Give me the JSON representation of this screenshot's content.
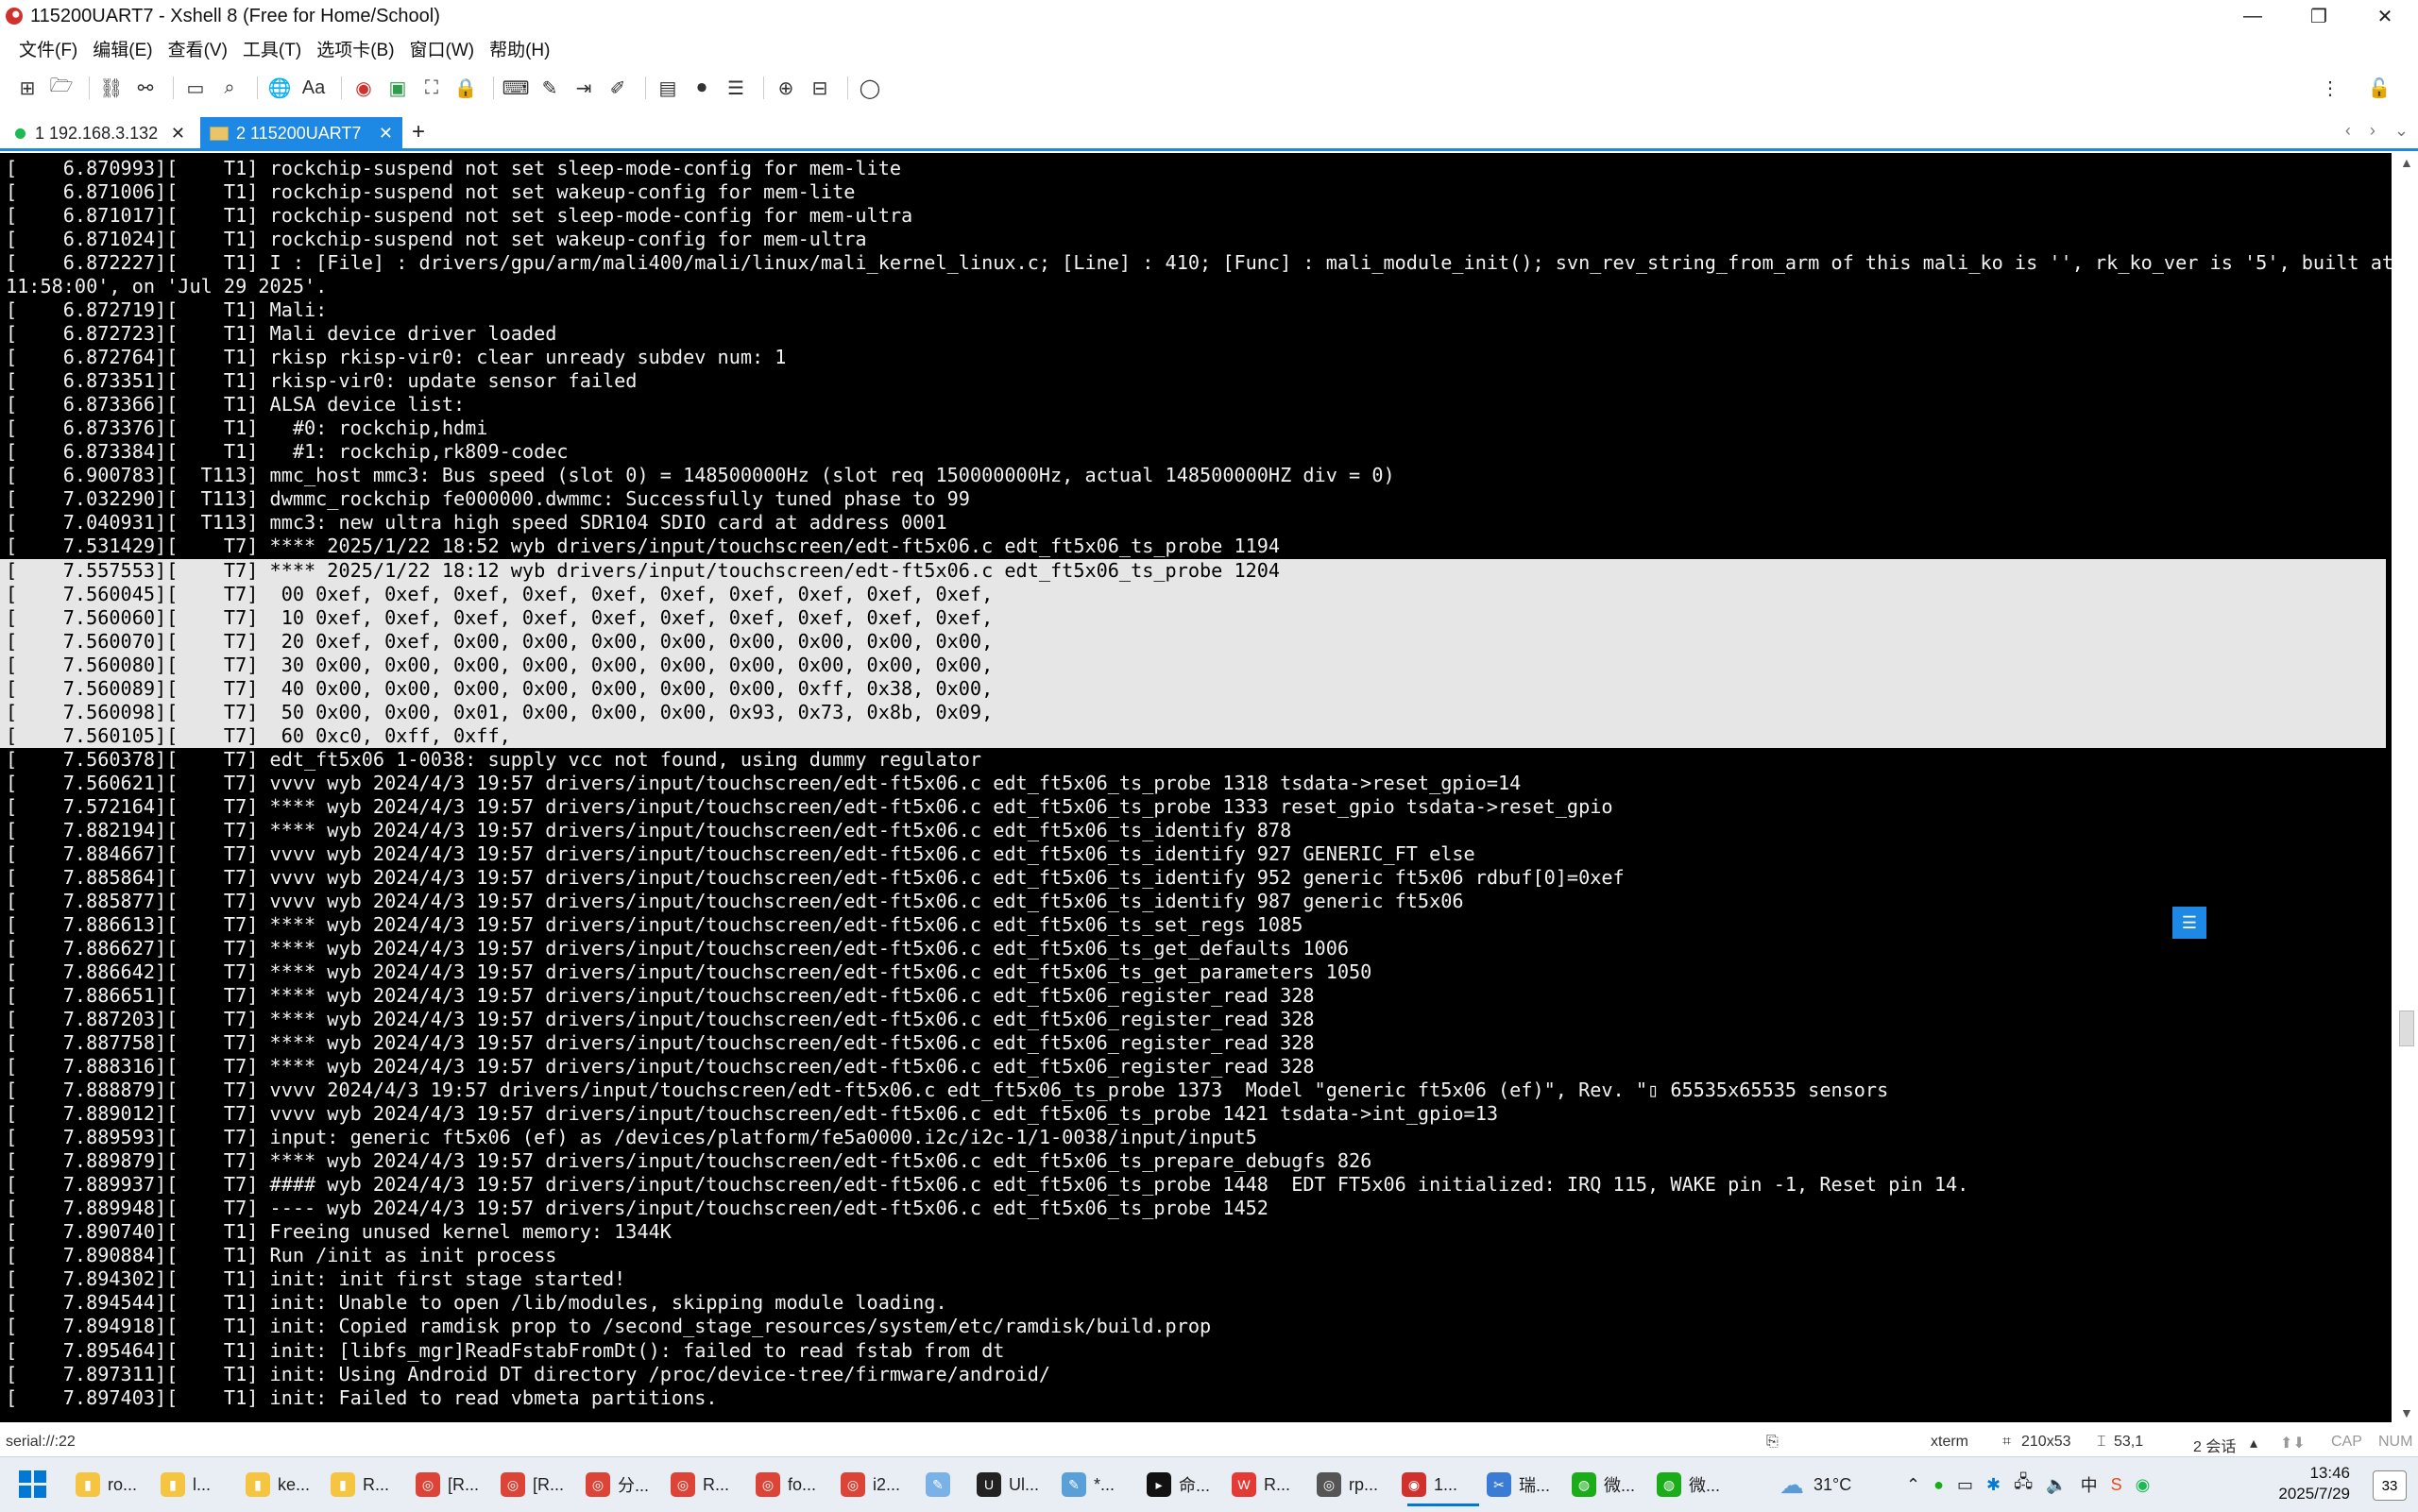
{
  "window": {
    "title": "115200UART7 - Xshell 8 (Free for Home/School)",
    "controls": [
      "—",
      "❐",
      "✕"
    ]
  },
  "menu": [
    "文件(F)",
    "编辑(E)",
    "查看(V)",
    "工具(T)",
    "选项卡(B)",
    "窗口(W)",
    "帮助(H)"
  ],
  "toolbar": {
    "font_label": "Aa"
  },
  "tabs": [
    {
      "label": "1 192.168.3.132",
      "active": false
    },
    {
      "label": "2 115200UART7",
      "active": true
    }
  ],
  "terminal": {
    "lines": [
      "[    6.870993][    T1] rockchip-suspend not set sleep-mode-config for mem-lite",
      "[    6.871006][    T1] rockchip-suspend not set wakeup-config for mem-lite",
      "[    6.871017][    T1] rockchip-suspend not set sleep-mode-config for mem-ultra",
      "[    6.871024][    T1] rockchip-suspend not set wakeup-config for mem-ultra",
      "[    6.872227][    T1] I : [File] : drivers/gpu/arm/mali400/mali/linux/mali_kernel_linux.c; [Line] : 410; [Func] : mali_module_init(); svn_rev_string_from_arm of this mali_ko is '', rk_ko_ver is '5', built at '",
      "11:58:00', on 'Jul 29 2025'.",
      "[    6.872719][    T1] Mali:",
      "[    6.872723][    T1] Mali device driver loaded",
      "[    6.872764][    T1] rkisp rkisp-vir0: clear unready subdev num: 1",
      "[    6.873351][    T1] rkisp-vir0: update sensor failed",
      "[    6.873366][    T1] ALSA device list:",
      "[    6.873376][    T1]   #0: rockchip,hdmi",
      "[    6.873384][    T1]   #1: rockchip,rk809-codec",
      "[    6.900783][  T113] mmc_host mmc3: Bus speed (slot 0) = 148500000Hz (slot req 150000000Hz, actual 148500000HZ div = 0)",
      "[    7.032290][  T113] dwmmc_rockchip fe000000.dwmmc: Successfully tuned phase to 99",
      "[    7.040931][  T113] mmc3: new ultra high speed SDR104 SDIO card at address 0001",
      "[    7.531429][    T7] **** 2025/1/22 18:52 wyb drivers/input/touchscreen/edt-ft5x06.c edt_ft5x06_ts_probe 1194",
      "[    7.557553][    T7] **** 2025/1/22 18:12 wyb drivers/input/touchscreen/edt-ft5x06.c edt_ft5x06_ts_probe 1204",
      "[    7.560045][    T7]  00 0xef, 0xef, 0xef, 0xef, 0xef, 0xef, 0xef, 0xef, 0xef, 0xef,",
      "[    7.560060][    T7]  10 0xef, 0xef, 0xef, 0xef, 0xef, 0xef, 0xef, 0xef, 0xef, 0xef,",
      "[    7.560070][    T7]  20 0xef, 0xef, 0x00, 0x00, 0x00, 0x00, 0x00, 0x00, 0x00, 0x00,",
      "[    7.560080][    T7]  30 0x00, 0x00, 0x00, 0x00, 0x00, 0x00, 0x00, 0x00, 0x00, 0x00,",
      "[    7.560089][    T7]  40 0x00, 0x00, 0x00, 0x00, 0x00, 0x00, 0x00, 0xff, 0x38, 0x00,",
      "[    7.560098][    T7]  50 0x00, 0x00, 0x01, 0x00, 0x00, 0x00, 0x93, 0x73, 0x8b, 0x09,",
      "[    7.560105][    T7]  60 0xc0, 0xff, 0xff,",
      "[    7.560378][    T7] edt_ft5x06 1-0038: supply vcc not found, using dummy regulator",
      "[    7.560621][    T7] vvvv wyb 2024/4/3 19:57 drivers/input/touchscreen/edt-ft5x06.c edt_ft5x06_ts_probe 1318 tsdata->reset_gpio=14",
      "[    7.572164][    T7] **** wyb 2024/4/3 19:57 drivers/input/touchscreen/edt-ft5x06.c edt_ft5x06_ts_probe 1333 reset_gpio tsdata->reset_gpio",
      "[    7.882194][    T7] **** wyb 2024/4/3 19:57 drivers/input/touchscreen/edt-ft5x06.c edt_ft5x06_ts_identify 878",
      "[    7.884667][    T7] vvvv wyb 2024/4/3 19:57 drivers/input/touchscreen/edt-ft5x06.c edt_ft5x06_ts_identify 927 GENERIC_FT else",
      "[    7.885864][    T7] vvvv wyb 2024/4/3 19:57 drivers/input/touchscreen/edt-ft5x06.c edt_ft5x06_ts_identify 952 generic ft5x06 rdbuf[0]=0xef",
      "[    7.885877][    T7] vvvv wyb 2024/4/3 19:57 drivers/input/touchscreen/edt-ft5x06.c edt_ft5x06_ts_identify 987 generic ft5x06",
      "[    7.886613][    T7] **** wyb 2024/4/3 19:57 drivers/input/touchscreen/edt-ft5x06.c edt_ft5x06_ts_set_regs 1085",
      "[    7.886627][    T7] **** wyb 2024/4/3 19:57 drivers/input/touchscreen/edt-ft5x06.c edt_ft5x06_ts_get_defaults 1006",
      "[    7.886642][    T7] **** wyb 2024/4/3 19:57 drivers/input/touchscreen/edt-ft5x06.c edt_ft5x06_ts_get_parameters 1050",
      "[    7.886651][    T7] **** wyb 2024/4/3 19:57 drivers/input/touchscreen/edt-ft5x06.c edt_ft5x06_register_read 328",
      "[    7.887203][    T7] **** wyb 2024/4/3 19:57 drivers/input/touchscreen/edt-ft5x06.c edt_ft5x06_register_read 328",
      "[    7.887758][    T7] **** wyb 2024/4/3 19:57 drivers/input/touchscreen/edt-ft5x06.c edt_ft5x06_register_read 328",
      "[    7.888316][    T7] **** wyb 2024/4/3 19:57 drivers/input/touchscreen/edt-ft5x06.c edt_ft5x06_register_read 328",
      "[    7.888879][    T7] vvvv 2024/4/3 19:57 drivers/input/touchscreen/edt-ft5x06.c edt_ft5x06_ts_probe 1373  Model \"generic ft5x06 (ef)\", Rev. \"▯ 65535x65535 sensors",
      "[    7.889012][    T7] vvvv wyb 2024/4/3 19:57 drivers/input/touchscreen/edt-ft5x06.c edt_ft5x06_ts_probe 1421 tsdata->int_gpio=13",
      "[    7.889593][    T7] input: generic ft5x06 (ef) as /devices/platform/fe5a0000.i2c/i2c-1/1-0038/input/input5",
      "[    7.889879][    T7] **** wyb 2024/4/3 19:57 drivers/input/touchscreen/edt-ft5x06.c edt_ft5x06_ts_prepare_debugfs 826",
      "[    7.889937][    T7] #### wyb 2024/4/3 19:57 drivers/input/touchscreen/edt-ft5x06.c edt_ft5x06_ts_probe 1448  EDT FT5x06 initialized: IRQ 115, WAKE pin -1, Reset pin 14.",
      "[    7.889948][    T7] ---- wyb 2024/4/3 19:57 drivers/input/touchscreen/edt-ft5x06.c edt_ft5x06_ts_probe 1452",
      "[    7.890740][    T1] Freeing unused kernel memory: 1344K",
      "[    7.890884][    T1] Run /init as init process",
      "[    7.894302][    T1] init: init first stage started!",
      "[    7.894544][    T1] init: Unable to open /lib/modules, skipping module loading.",
      "[    7.894918][    T1] init: Copied ramdisk prop to /second_stage_resources/system/etc/ramdisk/build.prop",
      "[    7.895464][    T1] init: [libfs_mgr]ReadFstabFromDt(): failed to read fstab from dt",
      "[    7.897311][    T1] init: Using Android DT directory /proc/device-tree/firmware/android/",
      "[    7.897403][    T1] init: Failed to read vbmeta partitions."
    ]
  },
  "ime": {
    "logo": "S",
    "mode": "中",
    "glyphs": [
      "•,",
      "🎤",
      "⌨",
      "👕",
      "▦",
      "✎"
    ]
  },
  "status": {
    "path": "serial://:22",
    "term": "xterm",
    "size": "210x53",
    "pos": "53,1",
    "sessions": "2 会话",
    "cap": "CAP",
    "num": "NUM"
  },
  "taskbar": {
    "apps": [
      {
        "label": "ro...",
        "icon": "folder"
      },
      {
        "label": "l...",
        "icon": "folder"
      },
      {
        "label": "ke...",
        "icon": "folder"
      },
      {
        "label": "R...",
        "icon": "folder"
      },
      {
        "label": "[R...",
        "icon": "chrome"
      },
      {
        "label": "[R...",
        "icon": "chrome"
      },
      {
        "label": "分...",
        "icon": "chrome"
      },
      {
        "label": "R...",
        "icon": "chrome"
      },
      {
        "label": "fo...",
        "icon": "chrome"
      },
      {
        "label": "i2...",
        "icon": "chrome"
      },
      {
        "label": "",
        "icon": "paint"
      },
      {
        "label": "Ul...",
        "icon": "ue"
      },
      {
        "label": "*...",
        "icon": "notepad"
      },
      {
        "label": "命...",
        "icon": "cmd"
      },
      {
        "label": "R...",
        "icon": "wps"
      },
      {
        "label": "rp...",
        "icon": "edge"
      },
      {
        "label": "1...",
        "icon": "xshell"
      },
      {
        "label": "瑞...",
        "icon": "tool"
      },
      {
        "label": "微...",
        "icon": "wechat"
      },
      {
        "label": "微...",
        "icon": "wechat"
      }
    ],
    "weather": "31°C",
    "time": "13:46",
    "date": "2025/7/29",
    "notifications": "33"
  }
}
